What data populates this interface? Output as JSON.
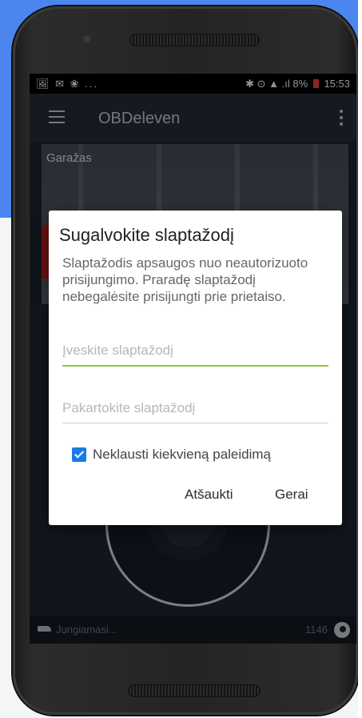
{
  "status_bar": {
    "left_icons": "🖼 ✉ ❀ ...",
    "right_icons": "✱ ⊙ ▲ .ıl",
    "battery": "8%",
    "time": "15:53"
  },
  "app_bar": {
    "title": "OBDeleven"
  },
  "garage": {
    "label": "Garažas"
  },
  "dialog": {
    "title": "Sugalvokite slaptažodį",
    "message": "Slaptažodis apsaugos nuo neautorizuoto prisijungimo. Praradę slaptažodį nebegalėsite prisijungti prie prietaiso.",
    "password_placeholder": "Įveskite slaptažodį",
    "confirm_placeholder": "Pakartokite slaptažodį",
    "checkbox_label": "Neklausti kiekvieną paleidimą",
    "checkbox_checked": true,
    "cancel_label": "Atšaukti",
    "ok_label": "Gerai"
  },
  "bottom_bar": {
    "status": "Jungiamasi...",
    "count": "1146"
  },
  "colors": {
    "accent_green": "#8cc63e",
    "checkbox_blue": "#1a7be4",
    "brand_blue_bg": "#4a86ee"
  }
}
